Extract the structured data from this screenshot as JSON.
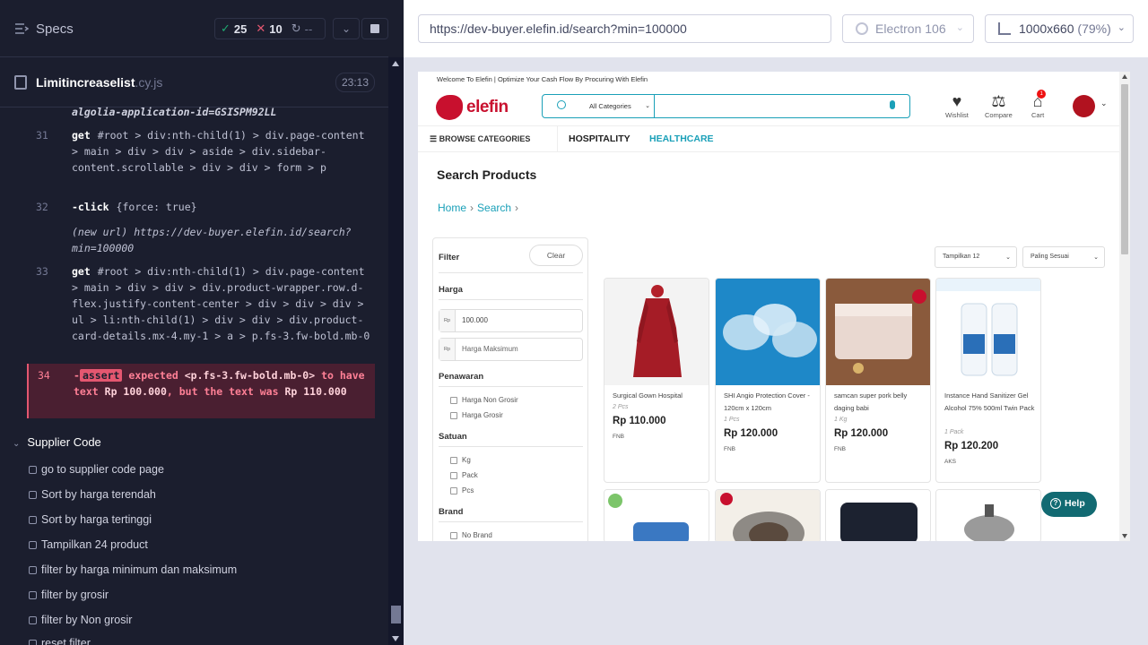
{
  "runner": {
    "specs_label": "Specs",
    "stats": {
      "passed": "25",
      "failed": "10",
      "pending": "--"
    },
    "spec_file": {
      "name": "Limitincreaselist",
      "ext": ".cy.js",
      "duration": "23:13"
    },
    "log_first_line": "algolia-application-id=GSISPM92LL",
    "commands": [
      {
        "num": "31",
        "name": "get",
        "message": "#root > div:nth-child(1) > div.page-content > main > div > div > aside > div.sidebar-content.scrollable > div > div > form > p"
      },
      {
        "num": "32",
        "name": "-click",
        "message": "{force: true}"
      },
      {
        "num": "",
        "name": "(new url)",
        "message": "https://dev-buyer.elefin.id/search?min=100000"
      },
      {
        "num": "33",
        "name": "get",
        "message": "#root > div:nth-child(1) > div.page-content > main > div > div > div.product-wrapper.row.d-flex.justify-content-center > div > div > div > ul > li:nth-child(1) > div > div > div.product-card-details.mx-4.my-1 > a > p.fs-3.fw-bold.mb-0"
      }
    ],
    "error": {
      "num": "34",
      "prefix": "-",
      "tag": "assert",
      "text1": "expected",
      "selector": "<p.fs-3.fw-bold.mb-0>",
      "text2": "to have text",
      "expected": "Rp 100.000",
      "text3": ", but the text was",
      "actual": "Rp 110.000"
    },
    "suite": "Supplier Code",
    "tests": [
      "go to supplier code page",
      "Sort by harga terendah",
      "Sort by harga tertinggi",
      "Tampilkan 24 product",
      "filter by harga minimum dan maksimum",
      "filter by grosir",
      "filter by Non grosir",
      "reset filter"
    ]
  },
  "browser": {
    "url": "https://dev-buyer.elefin.id/search?min=100000",
    "browser_name": "Electron 106",
    "viewport": "1000x660",
    "scale": "(79%)"
  },
  "site": {
    "welcome": "Welcome To Elefin | Optimize Your Cash Flow By Procuring With Elefin",
    "logo_text": "elefin",
    "category_select": "All Categories",
    "wishlist": "Wishlist",
    "compare": "Compare",
    "cart": "Cart",
    "cart_count": "1",
    "browse": "BROWSE CATEGORIES",
    "nav_hospitality": "HOSPITALITY",
    "nav_healthcare": "HEALTHCARE",
    "title": "Search Products",
    "breadcrumb": [
      "Home",
      "Search"
    ],
    "filter": {
      "title": "Filter",
      "clear": "Clear",
      "harga": "Harga",
      "rp": "Rp",
      "min_value": "100.000",
      "max_placeholder": "Harga Maksimum",
      "penawaran": "Penawaran",
      "penawaran_opts": [
        "Harga Non Grosir",
        "Harga Grosir"
      ],
      "satuan": "Satuan",
      "satuan_opts": [
        "Kg",
        "Pack",
        "Pcs"
      ],
      "brand": "Brand",
      "brand_opts": [
        "No Brand"
      ]
    },
    "show_select": "Tampilkan 12",
    "sort_select": "Paling Sesuai",
    "products": [
      {
        "name": "Surgical Gown Hospital",
        "unit": "2 Pcs",
        "price": "Rp 110.000",
        "category": "FNB"
      },
      {
        "name": "SHI Angio Protection Cover - 120cm x 120cm",
        "unit": "1 Pcs",
        "price": "Rp 120.000",
        "category": "FNB"
      },
      {
        "name": "samcan super pork belly daging babi",
        "unit": "1 Kg",
        "price": "Rp 120.000",
        "category": "FNB"
      },
      {
        "name": "Instance Hand Sanitizer Gel Alcohol 75% 500ml Twin Pack",
        "unit": "1 Pack",
        "price": "Rp 120.200",
        "category": "AKS"
      }
    ],
    "help": "Help"
  }
}
